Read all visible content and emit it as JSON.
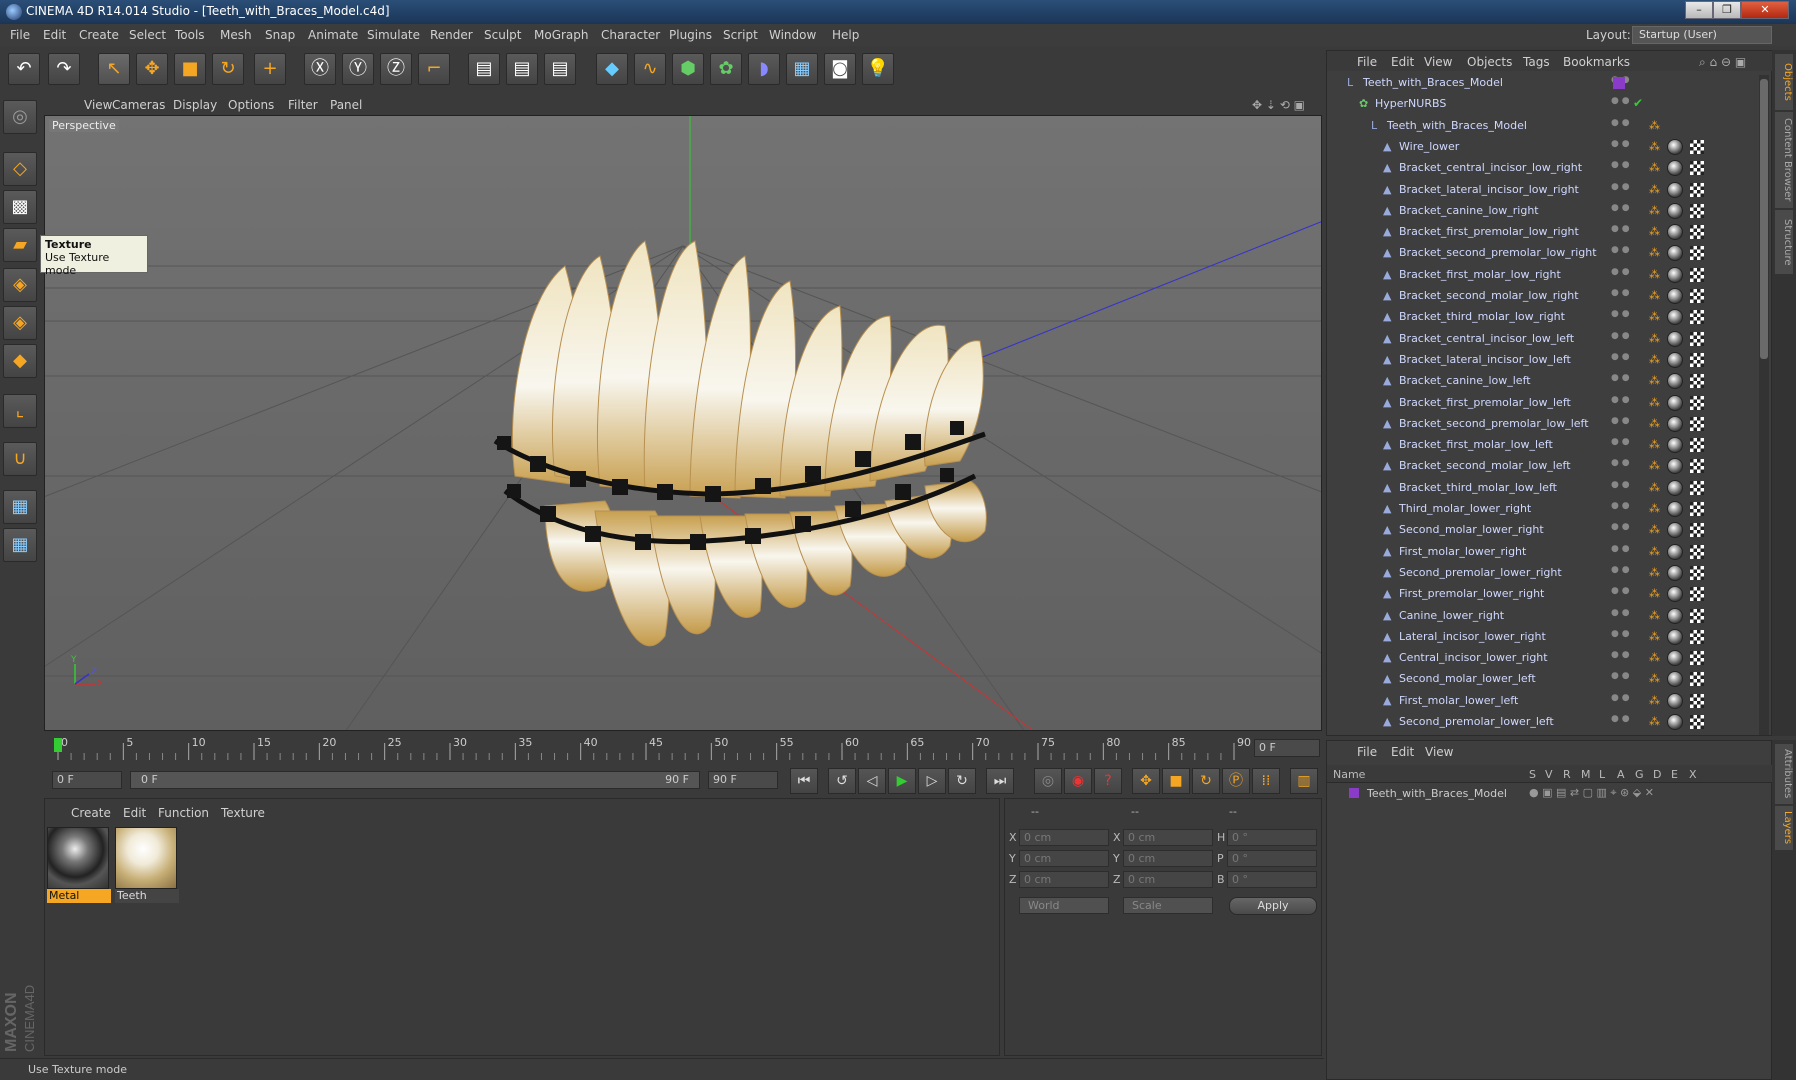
{
  "app": {
    "title": "CINEMA 4D R14.014 Studio - [Teeth_with_Braces_Model.c4d]",
    "window_buttons": [
      "–",
      "❐",
      "✕"
    ]
  },
  "menu": [
    "File",
    "Edit",
    "Create",
    "Select",
    "Tools",
    "Mesh",
    "Snap",
    "Animate",
    "Simulate",
    "Render",
    "Sculpt",
    "MoGraph",
    "Character",
    "Plugins",
    "Script",
    "Window",
    "Help"
  ],
  "layout": {
    "label": "Layout:",
    "value": "Startup (User)"
  },
  "viewport": {
    "menu": [
      "View",
      "Cameras",
      "Display",
      "Options",
      "Filter",
      "Panel"
    ],
    "label": "Perspective"
  },
  "tooltip": {
    "title": "Texture",
    "text": "Use Texture mode"
  },
  "timeline": {
    "ticks": [
      "0",
      "5",
      "10",
      "15",
      "20",
      "25",
      "30",
      "35",
      "40",
      "45",
      "50",
      "55",
      "60",
      "65",
      "70",
      "75",
      "80",
      "85",
      "90"
    ],
    "end_field": "0 F",
    "start_field": "0 F",
    "range_start": "0 F",
    "range_end": "90 F",
    "max_field": "90 F"
  },
  "materials": {
    "menu": [
      "Create",
      "Edit",
      "Function",
      "Texture"
    ],
    "items": [
      {
        "name": "Metal"
      },
      {
        "name": "Teeth"
      }
    ]
  },
  "coords": {
    "headers": [
      "--",
      "--",
      "--"
    ],
    "pos_labels": [
      "X",
      "Y",
      "Z"
    ],
    "size_labels": [
      "X",
      "Y",
      "Z"
    ],
    "rot_labels": [
      "H",
      "P",
      "B"
    ],
    "pos_values": [
      "0 cm",
      "0 cm",
      "0 cm"
    ],
    "size_values": [
      "0 cm",
      "0 cm",
      "0 cm"
    ],
    "rot_values": [
      "0 °",
      "0 °",
      "0 °"
    ],
    "mode1": "World",
    "mode2": "Scale",
    "apply": "Apply"
  },
  "objects": {
    "menu": [
      "File",
      "Edit",
      "View",
      "Objects",
      "Tags",
      "Bookmarks"
    ],
    "tree": [
      {
        "name": "Teeth_with_Braces_Model",
        "level": 0
      },
      {
        "name": "HyperNURBS",
        "level": 1
      },
      {
        "name": "Teeth_with_Braces_Model",
        "level": 2
      },
      {
        "name": "Wire_lower",
        "level": 3
      },
      {
        "name": "Bracket_central_incisor_low_right",
        "level": 3
      },
      {
        "name": "Bracket_lateral_incisor_low_right",
        "level": 3
      },
      {
        "name": "Bracket_canine_low_right",
        "level": 3
      },
      {
        "name": "Bracket_first_premolar_low_right",
        "level": 3
      },
      {
        "name": "Bracket_second_premolar_low_right",
        "level": 3
      },
      {
        "name": "Bracket_first_molar_low_right",
        "level": 3
      },
      {
        "name": "Bracket_second_molar_low_right",
        "level": 3
      },
      {
        "name": "Bracket_third_molar_low_right",
        "level": 3
      },
      {
        "name": "Bracket_central_incisor_low_left",
        "level": 3
      },
      {
        "name": "Bracket_lateral_incisor_low_left",
        "level": 3
      },
      {
        "name": "Bracket_canine_low_left",
        "level": 3
      },
      {
        "name": "Bracket_first_premolar_low_left",
        "level": 3
      },
      {
        "name": "Bracket_second_premolar_low_left",
        "level": 3
      },
      {
        "name": "Bracket_first_molar_low_left",
        "level": 3
      },
      {
        "name": "Bracket_second_molar_low_left",
        "level": 3
      },
      {
        "name": "Bracket_third_molar_low_left",
        "level": 3
      },
      {
        "name": "Third_molar_lower_right",
        "level": 3
      },
      {
        "name": "Second_molar_lower_right",
        "level": 3
      },
      {
        "name": "First_molar_lower_right",
        "level": 3
      },
      {
        "name": "Second_premolar_lower_right",
        "level": 3
      },
      {
        "name": "First_premolar_lower_right",
        "level": 3
      },
      {
        "name": "Canine_lower_right",
        "level": 3
      },
      {
        "name": "Lateral_incisor_lower_right",
        "level": 3
      },
      {
        "name": "Central_incisor_lower_right",
        "level": 3
      },
      {
        "name": "Second_molar_lower_left",
        "level": 3
      },
      {
        "name": "First_molar_lower_left",
        "level": 3
      },
      {
        "name": "Second_premolar_lower_left",
        "level": 3
      }
    ]
  },
  "sidetabs": [
    "Objects",
    "Content Browser",
    "Structure"
  ],
  "sidetabs2": [
    "Attributes",
    "Layers"
  ],
  "layers": {
    "menu": [
      "File",
      "Edit",
      "View"
    ],
    "columns": [
      "Name",
      "S",
      "V",
      "R",
      "M",
      "L",
      "A",
      "G",
      "D",
      "E",
      "X"
    ],
    "row": "Teeth_with_Braces_Model"
  },
  "status": "Use Texture mode",
  "logo": {
    "line1": "MAXON",
    "line2": "CINEMA4D"
  }
}
